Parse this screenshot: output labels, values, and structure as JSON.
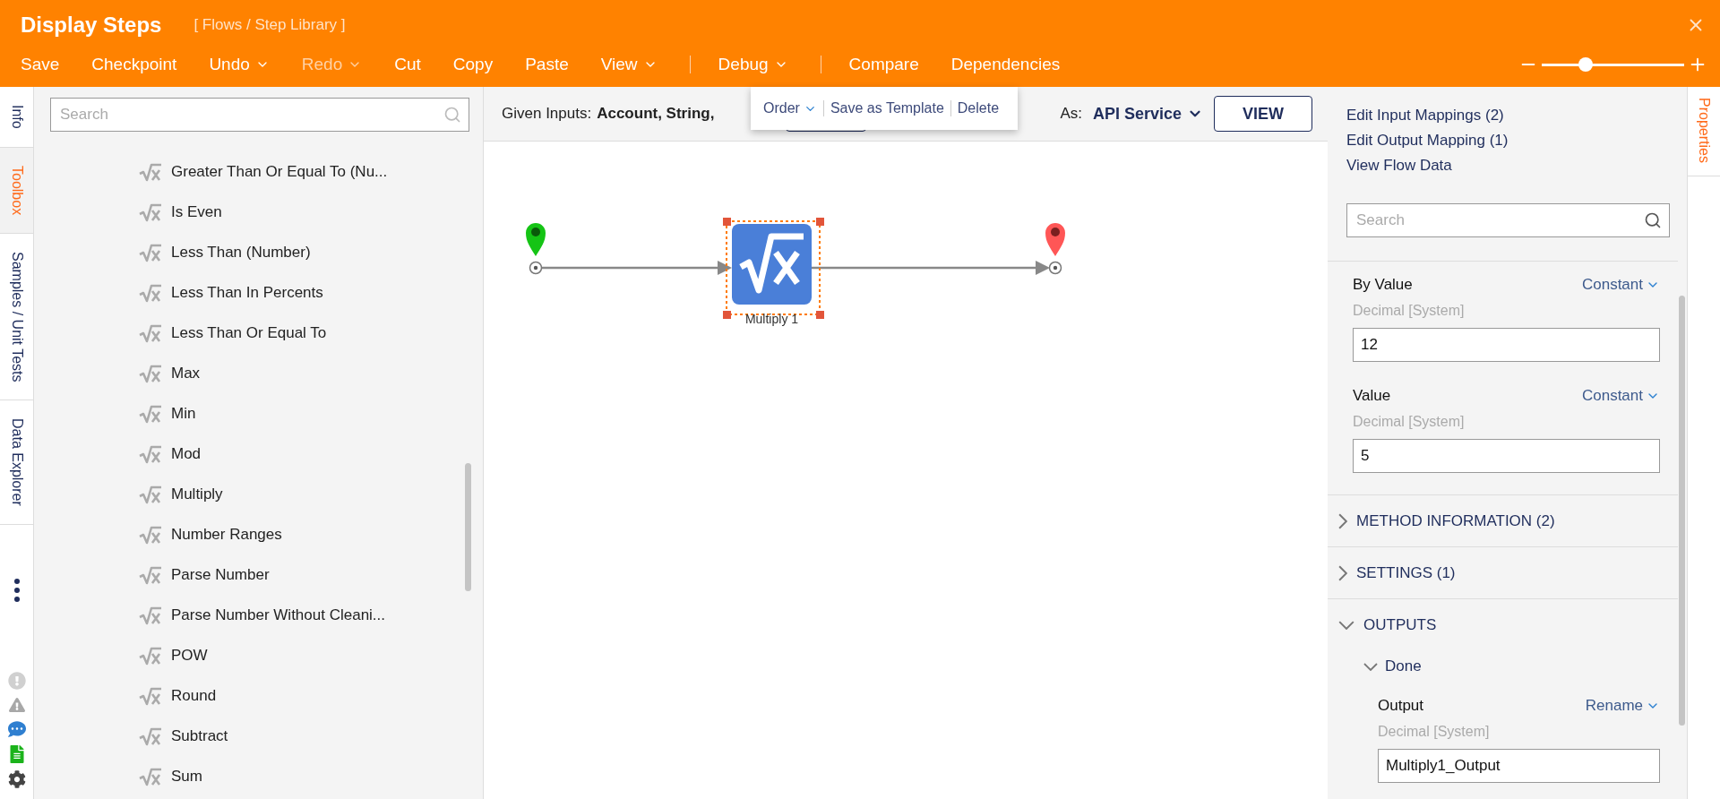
{
  "header": {
    "title": "Display Steps",
    "breadcrumb": "[ Flows / Step Library ]",
    "toolbar": [
      {
        "kind": "item",
        "label": "Save",
        "dropdown": false,
        "disabled": false
      },
      {
        "kind": "item",
        "label": "Checkpoint",
        "dropdown": false,
        "disabled": false
      },
      {
        "kind": "item",
        "label": "Undo",
        "dropdown": true,
        "disabled": false
      },
      {
        "kind": "item",
        "label": "Redo",
        "dropdown": true,
        "disabled": true
      },
      {
        "kind": "item",
        "label": "Cut",
        "dropdown": false,
        "disabled": false
      },
      {
        "kind": "item",
        "label": "Copy",
        "dropdown": false,
        "disabled": false
      },
      {
        "kind": "item",
        "label": "Paste",
        "dropdown": false,
        "disabled": false
      },
      {
        "kind": "item",
        "label": "View",
        "dropdown": true,
        "disabled": false
      },
      {
        "kind": "separator"
      },
      {
        "kind": "item",
        "label": "Debug",
        "dropdown": true,
        "disabled": false
      },
      {
        "kind": "separator"
      },
      {
        "kind": "item",
        "label": "Compare",
        "dropdown": false,
        "disabled": false
      },
      {
        "kind": "item",
        "label": "Dependencies",
        "dropdown": false,
        "disabled": false
      }
    ],
    "zoom": {
      "level": 0.31
    }
  },
  "left_rail": {
    "tabs": [
      {
        "label": "Info",
        "selected": false
      },
      {
        "label": "Toolbox",
        "selected": true
      },
      {
        "label": "Samples / Unit Tests",
        "selected": false
      },
      {
        "label": "Data Explorer",
        "selected": false
      }
    ]
  },
  "toolbox": {
    "search": {
      "placeholder": "Search"
    },
    "items": [
      "Greater Than Or Equal To (Nu...",
      "Is Even",
      "Less Than (Number)",
      "Less Than In Percents",
      "Less Than Or Equal To",
      "Max",
      "Min",
      "Mod",
      "Multiply",
      "Number Ranges",
      "Parse Number",
      "Parse Number Without Cleani...",
      "POW",
      "Round",
      "Subtract",
      "Sum"
    ]
  },
  "canvas": {
    "inputs_label": "Given Inputs:",
    "inputs_value": "Account, String,",
    "as_label": "As:",
    "as_value": "API Service",
    "view_button": "VIEW",
    "context_menu": [
      {
        "label": "Order",
        "dropdown": true
      },
      {
        "label": "Save as Template",
        "dropdown": false
      },
      {
        "label": "Delete",
        "dropdown": false
      }
    ],
    "step": {
      "label": "Multiply 1",
      "selected": true
    }
  },
  "properties": {
    "tab": "Properties",
    "links": [
      "Edit Input Mappings (2)",
      "Edit Output Mapping (1)",
      "View Flow Data"
    ],
    "search": {
      "placeholder": "Search"
    },
    "inputs": [
      {
        "label": "By Value",
        "mode": "Constant",
        "type": "Decimal [System]",
        "value": "12"
      },
      {
        "label": "Value",
        "mode": "Constant",
        "type": "Decimal [System]",
        "value": "5"
      }
    ],
    "sections": [
      {
        "title": "METHOD INFORMATION (2)",
        "expanded": false
      },
      {
        "title": "SETTINGS (1)",
        "expanded": false
      },
      {
        "title": "OUTPUTS",
        "expanded": true,
        "groups": [
          {
            "title": "Done",
            "expanded": true,
            "fields": [
              {
                "label": "Output",
                "mode": "Rename",
                "type": "Decimal [System]",
                "value": "Multiply1_Output"
              }
            ]
          }
        ]
      }
    ]
  }
}
